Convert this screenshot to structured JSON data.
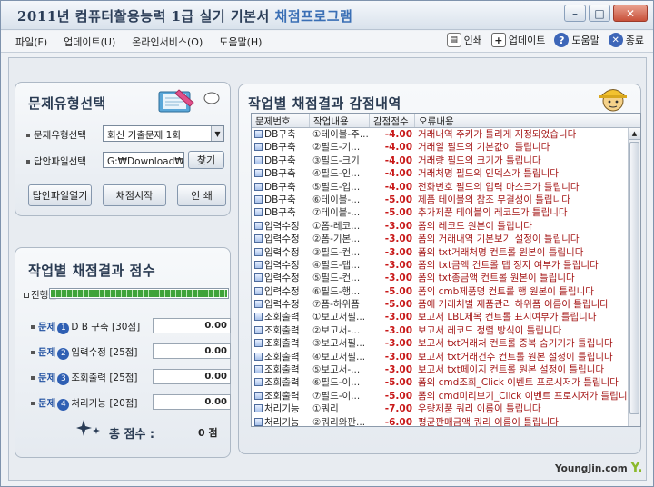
{
  "window": {
    "title_prefix": "2011년 컴퓨터활용능력 1급 실기 기본서",
    "title_accent": "채점프로그램"
  },
  "menu": [
    "파일(F)",
    "업데이트(U)",
    "온라인서비스(O)",
    "도움말(H)"
  ],
  "toolbar": {
    "print": "인쇄",
    "update": "업데이트",
    "help": "도움말",
    "exit": "종료"
  },
  "left_top": {
    "heading": "문제유형선택",
    "type_label": "문제유형선택",
    "type_value": "회신 기출문제 1회",
    "file_label": "답안파일선택",
    "file_value": "G:₩Download₩회신",
    "find_button": "찾기",
    "open_button": "답안파일열기",
    "grade_button": "채점시작",
    "print_button": "인    쇄"
  },
  "left_bottom": {
    "heading": "작업별 채점결과 점수",
    "progress_label": "진행률",
    "progress": 100,
    "problem_word": "문제",
    "categories": [
      {
        "num": "1",
        "label": "D B 구축",
        "points": "[30점]",
        "score": "0.00"
      },
      {
        "num": "2",
        "label": "입력수정",
        "points": "[25점]",
        "score": "0.00"
      },
      {
        "num": "3",
        "label": "조회출력",
        "points": "[25점]",
        "score": "0.00"
      },
      {
        "num": "4",
        "label": "처리기능",
        "points": "[20점]",
        "score": "0.00"
      }
    ],
    "total_label": "총 점수 :",
    "total_value": "0 점"
  },
  "results": {
    "heading": "작업별 채점결과 감점내역",
    "columns": [
      "문제번호",
      "작업내용",
      "감점점수",
      "오류내용"
    ],
    "rows": [
      [
        "DB구축",
        "①테이블-주...",
        "-4.00",
        "거래내역 주키가 틀리게 지정되었습니다"
      ],
      [
        "DB구축",
        "②필드-기...",
        "-4.00",
        "거래일 필드의 기본값이 틀립니다"
      ],
      [
        "DB구축",
        "③필드-크기",
        "-4.00",
        "거래량 필드의 크기가 틀립니다"
      ],
      [
        "DB구축",
        "④필드-인...",
        "-4.00",
        "거래처명 필드의 인덱스가 틀립니다"
      ],
      [
        "DB구축",
        "⑤필드-입...",
        "-4.00",
        "전화번호 필드의 입력 마스크가 틀립니다"
      ],
      [
        "DB구축",
        "⑥테이블-...",
        "-5.00",
        "제품 테이블의 참조 무결성이 틀립니다"
      ],
      [
        "DB구축",
        "⑦테이블-...",
        "-5.00",
        "추가제품 테이블의 레코드가 틀립니다"
      ],
      [
        "입력수정",
        "①폼-레코...",
        "-3.00",
        "폼의 레코드 원본이 틀립니다"
      ],
      [
        "입력수정",
        "②폼-기본...",
        "-3.00",
        "폼의 거래내역 기본보기 설정이 틀립니다"
      ],
      [
        "입력수정",
        "③필드-컨...",
        "-3.00",
        "폼의 txt거래처명 컨트롤 원본이 틀립니다"
      ],
      [
        "입력수정",
        "④필드-탭...",
        "-3.00",
        "폼의 txt금액 컨트롤 탭 정지 여부가 틀립니다"
      ],
      [
        "입력수정",
        "⑤필드-컨...",
        "-3.00",
        "폼의 txt총금액 컨트롤 원본이 틀립니다"
      ],
      [
        "입력수정",
        "⑥필드-행...",
        "-5.00",
        "폼의 cmb제품명 컨트롤 행 원본이 틀립니다"
      ],
      [
        "입력수정",
        "⑦폼-하위폼",
        "-5.00",
        "폼에 거래처별 제품관리 하위폼 이름이 틀립니다"
      ],
      [
        "조회출력",
        "①보고서필...",
        "-3.00",
        "보고서 LBL제목 컨트롤 표시여부가 틀립니다"
      ],
      [
        "조회출력",
        "②보고서-...",
        "-3.00",
        "보고서 레코드 정렬 방식이 틀립니다"
      ],
      [
        "조회출력",
        "③보고서필...",
        "-3.00",
        "보고서 txt거래처 컨트롤 중복 숨기기가 틀립니다"
      ],
      [
        "조회출력",
        "④보고서필...",
        "-3.00",
        "보고서 txt거래건수 컨트롤 원본 설정이 틀립니다"
      ],
      [
        "조회출력",
        "⑤보고서-...",
        "-3.00",
        "보고서 txt페이지 컨트롤 원본 설정이 틀립니다"
      ],
      [
        "조회출력",
        "⑥필드-이...",
        "-5.00",
        "폼의 cmd조회_Click 이벤트 프로시저가 틀립니다"
      ],
      [
        "조회출력",
        "⑦필드-이...",
        "-5.00",
        "폼의 cmd미리보기_Click 이벤트 프로시저가 틀립니"
      ],
      [
        "처리기능",
        "①쿼리",
        "-7.00",
        "우량제품 쿼리 이름이 틀립니다"
      ],
      [
        "처리기능",
        "②쿼리와판...",
        "-6.00",
        "평균판매금액 쿼리 이름이 틀립니다"
      ]
    ]
  },
  "brand": {
    "name": "YoungJin.com",
    "mark": "Y."
  }
}
